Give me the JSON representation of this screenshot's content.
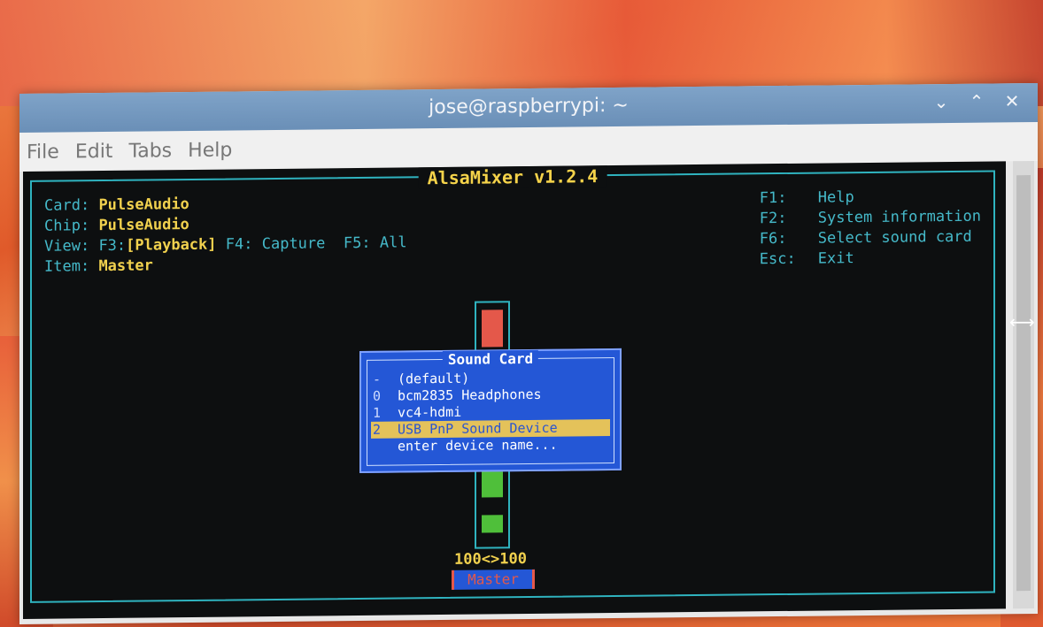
{
  "window": {
    "title": "jose@raspberrypi: ~",
    "controls": [
      "⌄",
      "⌃",
      "✕"
    ]
  },
  "menubar": [
    "File",
    "Edit",
    "Tabs",
    "Help"
  ],
  "alsamixer": {
    "title": "AlsaMixer v1.2.4",
    "card_label": "Card:",
    "card_value": "PulseAudio",
    "chip_label": "Chip:",
    "chip_value": "PulseAudio",
    "view_label": "View:",
    "view_f3": "F3:",
    "view_playback": "[Playback]",
    "view_f4": "F4:",
    "view_capture": "Capture",
    "view_f5": "F5:",
    "view_all": "All",
    "item_label": "Item:",
    "item_value": "Master",
    "keys": [
      {
        "key": "F1:",
        "desc": "Help"
      },
      {
        "key": "F2:",
        "desc": "System information"
      },
      {
        "key": "F6:",
        "desc": "Select sound card"
      },
      {
        "key": "Esc:",
        "desc": "Exit"
      }
    ],
    "volume_display": "100<>100",
    "channel_name": "Master"
  },
  "sound_card_dialog": {
    "title": "Sound Card",
    "options": [
      {
        "index": "-",
        "label": "(default)"
      },
      {
        "index": "0",
        "label": "bcm2835 Headphones"
      },
      {
        "index": "1",
        "label": "vc4-hdmi"
      },
      {
        "index": "2",
        "label": "USB PnP Sound Device",
        "selected": true
      },
      {
        "index": "",
        "label": "enter device name..."
      }
    ]
  },
  "colors": {
    "terminal_bg": "#0d0f10",
    "cyan": "#45b9c9",
    "yellow": "#f1d14e",
    "dialog_blue": "#2457d6",
    "selection": "#e4c25a"
  }
}
